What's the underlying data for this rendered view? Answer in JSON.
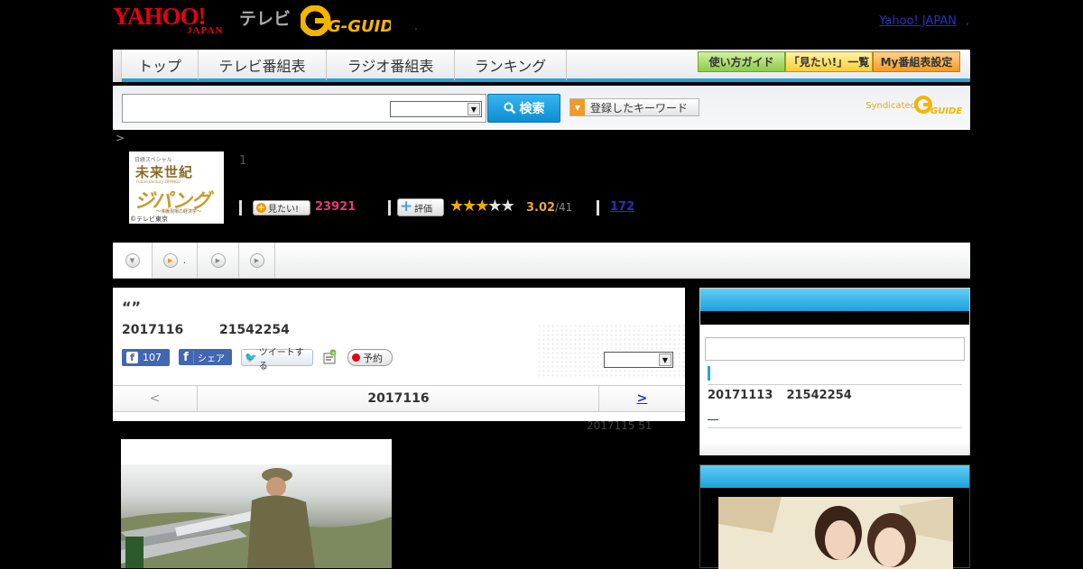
{
  "header": {
    "logo_yahoo": "YAHOO!",
    "logo_japan": "JAPAN",
    "logo_tv": "テレビ",
    "logo_gguide": "G-GUIDE",
    "dot": ".",
    "yahoo_japan_link": "Yahoo! JAPAN",
    "link_separator": ","
  },
  "nav": {
    "tabs": [
      {
        "label": "トップ"
      },
      {
        "label": "テレビ番組表"
      },
      {
        "label": "ラジオ番組表"
      },
      {
        "label": "ランキング"
      }
    ],
    "util_buttons": [
      {
        "label": "使い方ガイド",
        "color": "#a6d86a"
      },
      {
        "label": "「見たい!」一覧",
        "color": "#ffde59"
      },
      {
        "label": "My番組表設定",
        "color": "#f9a23b"
      }
    ],
    "accent_color": "#2a9fd9"
  },
  "search": {
    "input_value": "",
    "select_value": "",
    "button_label": "検索",
    "keyword_button_label": "登録したキーワード",
    "syndicated_label": "Syndicated"
  },
  "breadcrumb": ">",
  "program": {
    "thumb_small": "日経スペシャル",
    "thumb_title": "未来世紀",
    "thumb_sub": "Future Century ZIPANGU",
    "thumb_logo": "ジパング",
    "thumb_tag": "～沸騰現場の経済学～",
    "thumb_copyright": "©テレビ東京",
    "episode_number": "1",
    "mitai_label": "見たい!",
    "mitai_count": "23921",
    "hyoka_label": "評価",
    "stars_filled": 3,
    "stars_total": 5,
    "rating": "3.02",
    "rating_count": "/41",
    "review_count": "172"
  },
  "tabs": [
    {
      "icon": "down-arrow-icon",
      "label": ""
    },
    {
      "icon": "play-icon",
      "label": "."
    },
    {
      "icon": "play-icon",
      "label": ""
    },
    {
      "icon": "play-icon",
      "label": ""
    }
  ],
  "main": {
    "title": "“”",
    "date": "2017116",
    "time": "21542254",
    "fb_like_count": "107",
    "fb_share_label": "シェア",
    "tweet_label": "ツイートする",
    "reserve_label": "予約",
    "select_value": "",
    "date_nav": {
      "prev": "<",
      "current": "2017116",
      "next": ">"
    },
    "update_text": "2017115  51"
  },
  "sidebar": {
    "search_value": "",
    "broadcast_date": "20171113",
    "broadcast_time": "21542254",
    "link": "＿"
  }
}
